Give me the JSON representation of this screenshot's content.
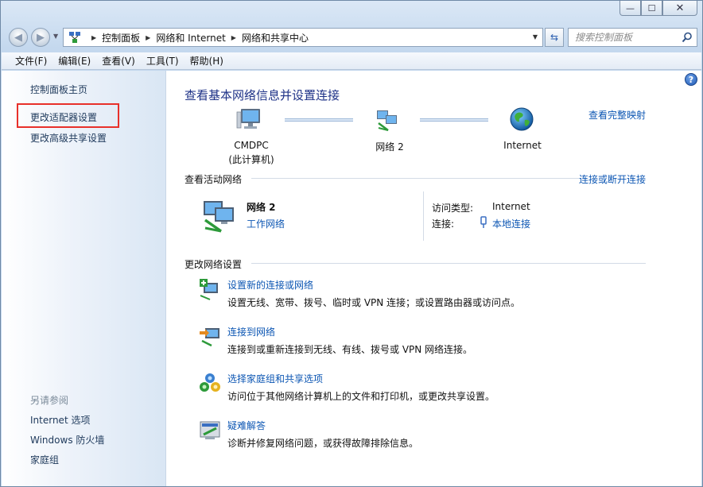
{
  "window": {
    "caption": {
      "minimize": "—",
      "maximize": "☐",
      "close": "✕"
    }
  },
  "nav": {
    "breadcrumbs": [
      "控制面板",
      "网络和 Internet",
      "网络和共享中心"
    ],
    "search_placeholder": "搜索控制面板"
  },
  "menu": [
    "文件(F)",
    "编辑(E)",
    "查看(V)",
    "工具(T)",
    "帮助(H)"
  ],
  "sidebar": {
    "home": "控制面板主页",
    "links": [
      "更改适配器设置",
      "更改高级共享设置"
    ],
    "see_also_heading": "另请参阅",
    "see_also": [
      "Internet 选项",
      "Windows 防火墙",
      "家庭组"
    ]
  },
  "main": {
    "title": "查看基本网络信息并设置连接",
    "full_map_link": "查看完整映射",
    "map": {
      "computer_name": "CMDPC",
      "computer_sub": "(此计算机)",
      "network": "网络  2",
      "internet": "Internet"
    },
    "active_networks": {
      "title": "查看活动网络",
      "connect_link": "连接或断开连接",
      "network_name": "网络  2",
      "network_type": "工作网络",
      "access_type_label": "访问类型:",
      "access_type_value": "Internet",
      "connection_label": "连接:",
      "connection_value": "本地连接"
    },
    "change_settings": {
      "title": "更改网络设置",
      "tasks": [
        {
          "title": "设置新的连接或网络",
          "desc": "设置无线、宽带、拨号、临时或 VPN 连接；或设置路由器或访问点。"
        },
        {
          "title": "连接到网络",
          "desc": "连接到或重新连接到无线、有线、拨号或 VPN 网络连接。"
        },
        {
          "title": "选择家庭组和共享选项",
          "desc": "访问位于其他网络计算机上的文件和打印机，或更改共享设置。"
        },
        {
          "title": "疑难解答",
          "desc": "诊断并修复网络问题，或获得故障排除信息。"
        }
      ]
    }
  },
  "colors": {
    "link": "#0c56b3",
    "title": "#1e3287",
    "highlight_box": "#e8302a"
  }
}
